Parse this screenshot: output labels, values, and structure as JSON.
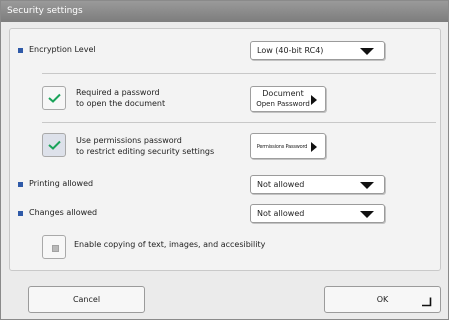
{
  "window": {
    "title": "Security settings"
  },
  "encryption": {
    "label": "Encryption Level",
    "selected": "Low (40-bit RC4)"
  },
  "open_password": {
    "checked": true,
    "label_line1": "Required a password",
    "label_line2": "to open the document",
    "button_line1": "Document",
    "button_line2": "Open Password"
  },
  "permissions_password": {
    "checked": true,
    "label_line1": "Use permissions password",
    "label_line2": "to restrict editing security settings",
    "button_label": "Permissions Password"
  },
  "printing": {
    "label": "Printing allowed",
    "selected": "Not allowed"
  },
  "changes": {
    "label": "Changes allowed",
    "selected": "Not allowed"
  },
  "copying": {
    "checked": false,
    "label": "Enable copying of text, images, and accesibility"
  },
  "footer": {
    "cancel_label": "Cancel",
    "ok_label": "OK"
  },
  "colors": {
    "bullet": "#2f5aa8",
    "check": "#1aa35a"
  }
}
